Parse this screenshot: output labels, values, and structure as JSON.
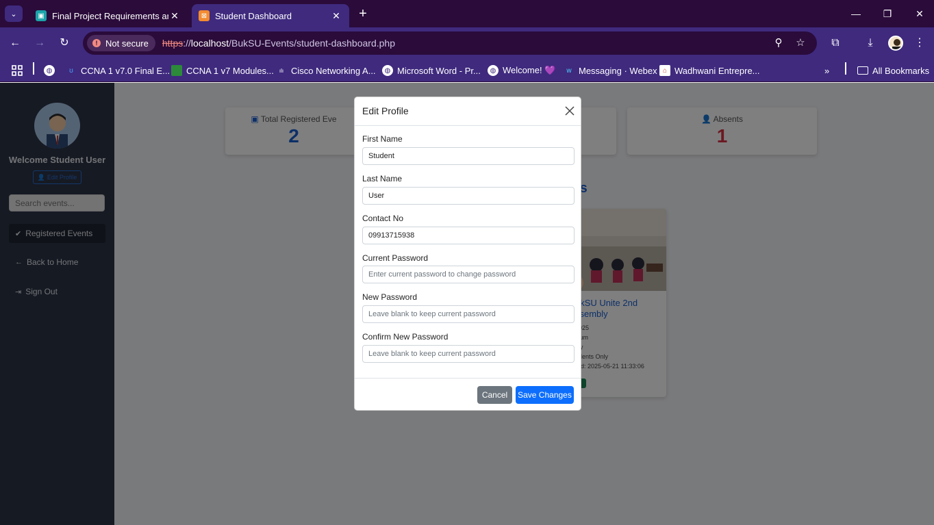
{
  "browser": {
    "tabs": [
      {
        "title": "Final Project Requirements and",
        "active": false
      },
      {
        "title": "Student Dashboard",
        "active": true
      }
    ],
    "security_label": "Not secure",
    "url_scheme": "https",
    "url_sep": "://",
    "url_host": "localhost",
    "url_path": "/BukSU-Events/student-dashboard.php",
    "bookmarks": [
      {
        "label": "CCNA 1 v7.0 Final E..."
      },
      {
        "label": "CCNA 1 v7 Modules..."
      },
      {
        "label": "Cisco Networking A..."
      },
      {
        "label": "Microsoft Word - Pr..."
      },
      {
        "label": "Welcome! 💜"
      },
      {
        "label": "Messaging · Webex"
      },
      {
        "label": "Wadhwani Entrepre..."
      }
    ],
    "all_bookmarks": "All Bookmarks"
  },
  "sidebar": {
    "welcome": "Welcome Student User",
    "edit_profile": "Edit Profile",
    "search_placeholder": "Search events...",
    "nav": [
      {
        "label": "Registered Events",
        "active": true
      },
      {
        "label": "Back to Home",
        "active": false
      },
      {
        "label": "Sign Out",
        "active": false
      }
    ]
  },
  "stats": [
    {
      "label": "Total Registered Eve",
      "value": "2",
      "color": "#1a5fd1"
    },
    {
      "label": "Absents",
      "value": "1",
      "color": "#d63343"
    }
  ],
  "section_title_fragment": "ts",
  "event": {
    "title_line1": "ukSU Unite 2nd",
    "title_line2": "ssembly",
    "meta": [
      "2025",
      "sium",
      "bly",
      "udents Only",
      "red: 2025-05-21 11:33:06"
    ]
  },
  "modal": {
    "title": "Edit Profile",
    "fields": [
      {
        "label": "First Name",
        "value": "Student",
        "placeholder": ""
      },
      {
        "label": "Last Name",
        "value": "User",
        "placeholder": ""
      },
      {
        "label": "Contact No",
        "value": "09913715938",
        "placeholder": ""
      },
      {
        "label": "Current Password",
        "value": "",
        "placeholder": "Enter current password to change password"
      },
      {
        "label": "New Password",
        "value": "",
        "placeholder": "Leave blank to keep current password"
      },
      {
        "label": "Confirm New Password",
        "value": "",
        "placeholder": "Leave blank to keep current password"
      }
    ],
    "cancel": "Cancel",
    "save": "Save Changes"
  }
}
